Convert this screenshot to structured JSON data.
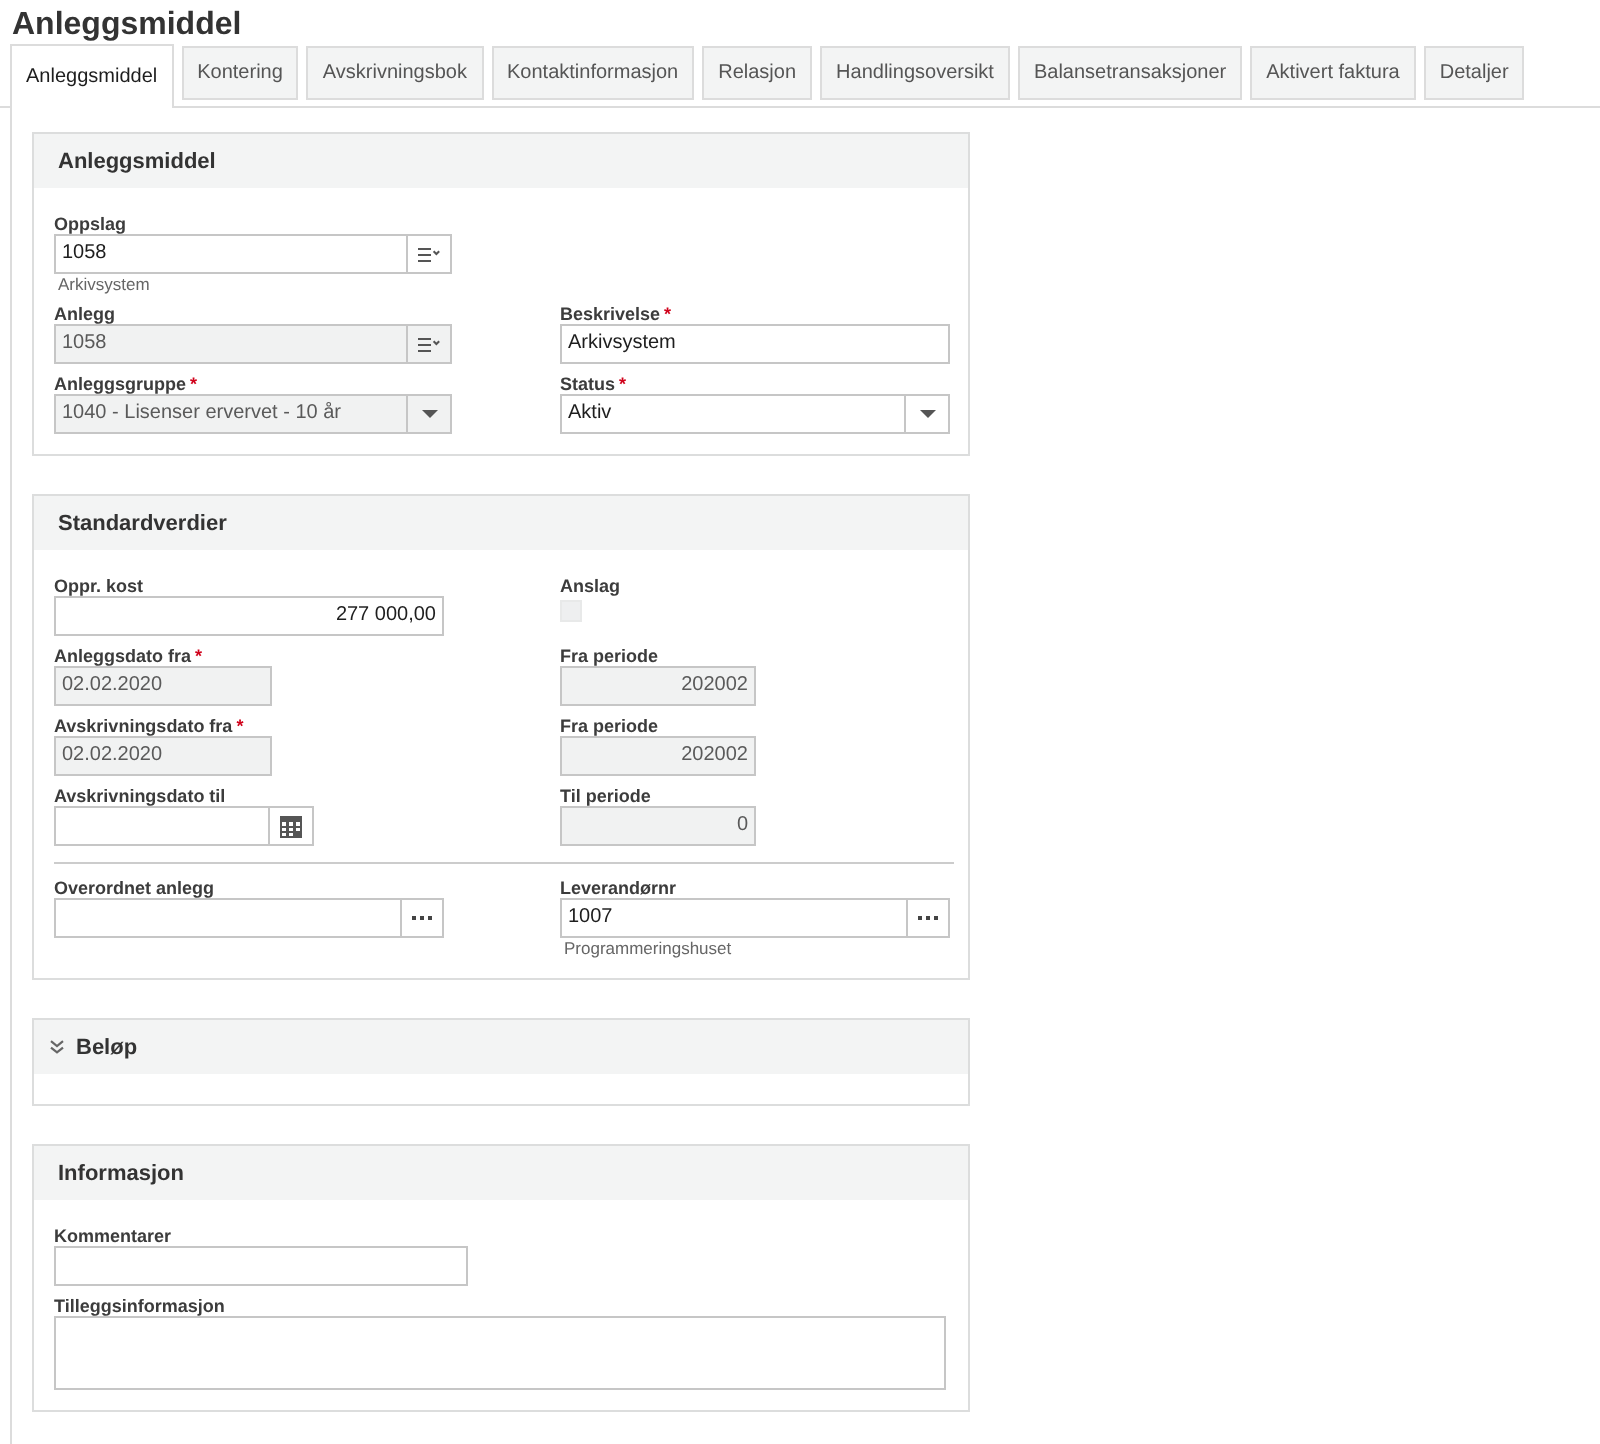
{
  "page": {
    "title": "Anleggsmiddel"
  },
  "tabs": [
    {
      "label": "Anleggsmiddel",
      "selected": true
    },
    {
      "label": "Kontering",
      "selected": false
    },
    {
      "label": "Avskrivningsbok",
      "selected": false
    },
    {
      "label": "Kontaktinformasjon",
      "selected": false
    },
    {
      "label": "Relasjon",
      "selected": false
    },
    {
      "label": "Handlingsoversikt",
      "selected": false
    },
    {
      "label": "Balansetransaksjoner",
      "selected": false
    },
    {
      "label": "Aktivert faktura",
      "selected": false
    },
    {
      "label": "Detaljer",
      "selected": false
    }
  ],
  "sections": [
    {
      "title": "Anleggsmiddel",
      "kind": "panel",
      "groups": [
        {
          "rows": [
            {
              "fields": [
                {
                  "label": "Oppslag",
                  "kind": "lookup",
                  "value": "1058",
                  "disabled": false,
                  "hint": "Arkivsystem"
                }
              ]
            },
            {
              "fields": [
                {
                  "label": "Anlegg",
                  "kind": "lookup",
                  "value": "1058",
                  "disabled": true
                },
                {
                  "label": "Beskrivelse",
                  "required_mark": "*",
                  "kind": "text",
                  "value": "Arkivsystem",
                  "disabled": false
                }
              ]
            },
            {
              "fields": [
                {
                  "label": "Anleggsgruppe",
                  "required_mark": "*",
                  "kind": "select",
                  "value": "1040 - Lisenser ervervet - 10 år",
                  "disabled": true
                },
                {
                  "label": "Status",
                  "required_mark": "*",
                  "kind": "select",
                  "value": "Aktiv",
                  "disabled": false
                }
              ]
            }
          ]
        }
      ]
    },
    {
      "title": "Standardverdier",
      "kind": "panel",
      "groups": [
        {
          "rows": [
            {
              "fields": [
                {
                  "label": "Oppr. kost",
                  "kind": "number",
                  "value": "277 000,00",
                  "disabled": false
                },
                {
                  "label": "Anslag",
                  "kind": "checkbox",
                  "checked": false,
                  "disabled": true
                }
              ]
            },
            {
              "fields": [
                {
                  "label": "Anleggsdato fra",
                  "required_mark": "*",
                  "kind": "text",
                  "value": "02.02.2020",
                  "disabled": true
                },
                {
                  "label": "Fra periode",
                  "kind": "number",
                  "value": "202002",
                  "disabled": true
                }
              ]
            },
            {
              "fields": [
                {
                  "label": "Avskrivningsdato fra",
                  "required_mark": "*",
                  "kind": "text",
                  "value": "02.02.2020",
                  "disabled": true
                },
                {
                  "label": "Fra periode",
                  "kind": "number",
                  "value": "202002",
                  "disabled": true
                }
              ]
            },
            {
              "fields": [
                {
                  "label": "Avskrivningsdato til",
                  "kind": "date",
                  "disabled": false
                },
                {
                  "label": "Til periode",
                  "kind": "number",
                  "value": "0",
                  "disabled": true
                }
              ]
            }
          ]
        },
        {
          "rows": [
            {
              "fields": [
                {
                  "label": "Overordnet anlegg",
                  "kind": "browse",
                  "disabled": false
                },
                {
                  "label": "Leverandørnr",
                  "kind": "browse",
                  "value": "1007",
                  "disabled": false,
                  "hint": "Programmeringshuset"
                }
              ]
            }
          ]
        }
      ]
    },
    {
      "title": "Beløp",
      "kind": "collapsible",
      "expanded": false
    },
    {
      "title": "Informasjon",
      "kind": "panel",
      "groups": [
        {
          "rows": [
            {
              "fields": [
                {
                  "label": "Kommentarer",
                  "kind": "text",
                  "disabled": false
                }
              ]
            },
            {
              "fields": [
                {
                  "label": "Tilleggsinformasjon",
                  "kind": "textarea",
                  "disabled": false
                }
              ]
            }
          ]
        }
      ]
    }
  ]
}
